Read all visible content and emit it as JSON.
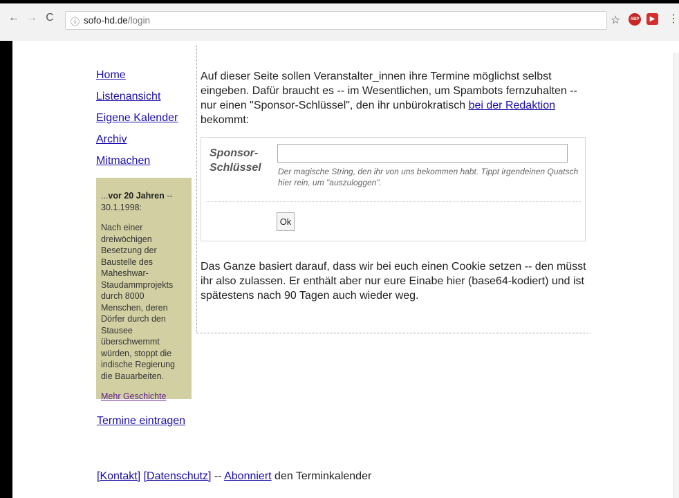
{
  "browser": {
    "back": "←",
    "forward": "→",
    "reload": "C",
    "info": "ⓘ",
    "host": "sofo-hd.de",
    "path": "/login",
    "star": "☆",
    "ext_abp": "ABP",
    "ext_other": "▶",
    "menu": "⋮"
  },
  "nav": {
    "items": [
      "Home",
      "Listenansicht",
      "Eigene Kalender",
      "Archiv",
      "Mitmachen"
    ]
  },
  "history": {
    "prefix": "...",
    "bold": "vor 20 Jahren",
    "suffix": " -- 30.1.1998:",
    "text": "Nach einer dreiwöchigen Besetzung der Baustelle des Maheshwar-Staudammprojekts durch 8000 Menschen, deren Dörfer durch den Stausee überschwemmt würden, stoppt die indische Regierung die Bauarbeiten.",
    "more": "Mehr Geschichte"
  },
  "termine_link": "Termine eintragen",
  "intro": {
    "before": "Auf dieser Seite sollen Veranstalter_innen ihre Termine möglichst selbst eingeben. Dafür braucht es -- im Wesentlichen, um Spambots fernzuhalten -- nur einen \"Sponsor-Schlüssel\", den ihr unbürokratisch ",
    "link": "bei der Redaktion",
    "after": " bekommt:"
  },
  "form": {
    "label": "Sponsor-Schlüssel",
    "input_value": "",
    "hint": "Der magische String, den ihr von uns bekommen habt. Tippt irgendeinen Quatsch hier rein, um \"auszuloggen\".",
    "ok": "Ok"
  },
  "cookie_text": "Das Ganze basiert darauf, dass wir bei euch einen Cookie setzen -- den müsst ihr also zulassen. Er enthält aber nur eure Einabe hier (base64-kodiert) und ist spätestens nach 90 Tagen auch wieder weg.",
  "footer": {
    "kontakt": "[Kontakt]",
    "datenschutz": "[Datenschutz]",
    "sep": " -- ",
    "abonniert": "Abonniert",
    "rest": " den Terminkalender"
  }
}
